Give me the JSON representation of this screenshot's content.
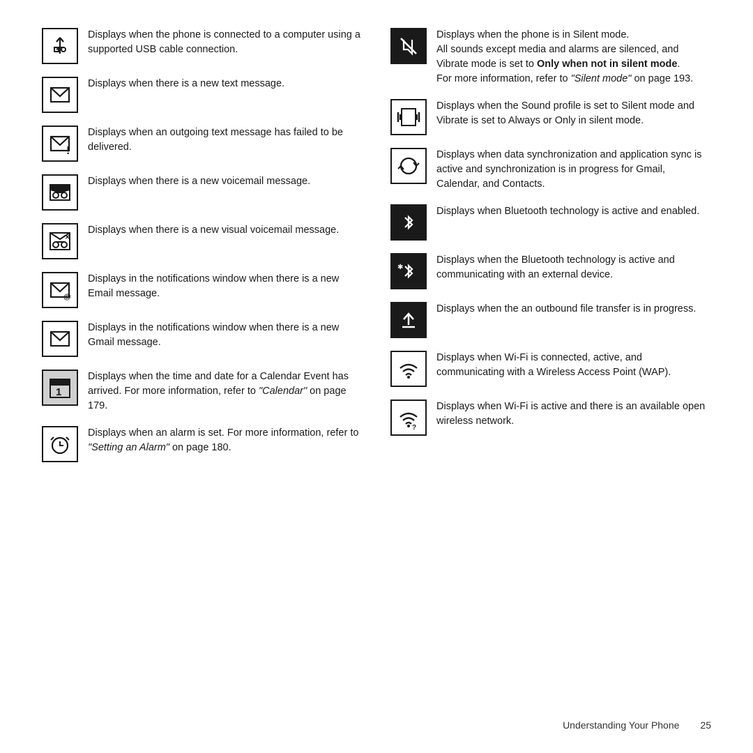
{
  "left_column": [
    {
      "id": "usb",
      "icon_type": "usb",
      "desc": "Displays when the phone is connected to a computer using a supported USB cable connection."
    },
    {
      "id": "sms",
      "icon_type": "sms",
      "desc": "Displays when there is a new text message."
    },
    {
      "id": "sms-fail",
      "icon_type": "sms-fail",
      "desc": "Displays when an outgoing text message has failed to be delivered."
    },
    {
      "id": "voicemail",
      "icon_type": "voicemail",
      "desc": "Displays when there is a new voicemail message."
    },
    {
      "id": "visual-voicemail",
      "icon_type": "visual-voicemail",
      "desc": "Displays when there is a new visual voicemail message."
    },
    {
      "id": "email",
      "icon_type": "email",
      "desc": "Displays in the notifications window when there is a new Email message."
    },
    {
      "id": "gmail",
      "icon_type": "gmail",
      "desc": "Displays in the notifications window when there is a new Gmail message."
    },
    {
      "id": "calendar",
      "icon_type": "calendar",
      "desc": "Displays when the time and date for a Calendar Event has arrived. For more information, refer to ",
      "italic": "\"Calendar\"",
      "desc2": " on page 179."
    },
    {
      "id": "alarm",
      "icon_type": "alarm",
      "desc": "Displays when an alarm is set. For more information, refer to ",
      "italic": "\"Setting an Alarm\"",
      "desc2": " on page 180."
    }
  ],
  "right_column": [
    {
      "id": "silent",
      "icon_type": "silent",
      "desc": "Displays when the phone is in Silent mode.",
      "extra": "All sounds except media and alarms are silenced, and Vibrate mode is set to ",
      "bold": "Only when not in silent mode",
      "extra2": ".\nFor more information, refer to ",
      "italic": "\"Silent mode\"",
      "extra3": " on page 193."
    },
    {
      "id": "vibrate",
      "icon_type": "vibrate",
      "desc": "Displays when the Sound profile is set to Silent mode and Vibrate is set to Always or Only in silent mode."
    },
    {
      "id": "sync",
      "icon_type": "sync",
      "desc": "Displays when data synchronization and application sync is active and synchronization is in progress for Gmail, Calendar, and Contacts."
    },
    {
      "id": "bluetooth",
      "icon_type": "bluetooth",
      "desc": "Displays when Bluetooth technology is active and enabled."
    },
    {
      "id": "bluetooth-active",
      "icon_type": "bluetooth-active",
      "desc": "Displays when the Bluetooth technology is active and communicating with an external device."
    },
    {
      "id": "upload",
      "icon_type": "upload",
      "desc": "Displays when the an outbound file transfer is in progress."
    },
    {
      "id": "wifi",
      "icon_type": "wifi",
      "desc": "Displays when Wi-Fi is connected, active, and communicating with a Wireless Access Point (WAP)."
    },
    {
      "id": "wifi-open",
      "icon_type": "wifi-open",
      "desc": "Displays when Wi-Fi is active and there is an available open wireless network."
    }
  ],
  "footer": {
    "chapter": "Understanding Your Phone",
    "page_number": "25"
  }
}
